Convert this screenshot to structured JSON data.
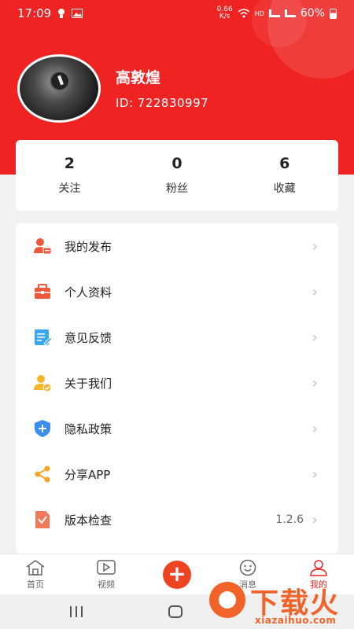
{
  "status_bar": {
    "time": "17:09",
    "net_speed_top": "0.66",
    "net_speed_unit": "K/s",
    "hd_label": "HD",
    "battery": "60%"
  },
  "profile": {
    "name": "高敦煌",
    "id_text": "ID: 722830997"
  },
  "stats": [
    {
      "value": "2",
      "label": "关注"
    },
    {
      "value": "0",
      "label": "粉丝"
    },
    {
      "value": "6",
      "label": "收藏"
    }
  ],
  "menu": [
    {
      "label": "我的发布",
      "icon": "user-post-icon",
      "value": ""
    },
    {
      "label": "个人资料",
      "icon": "toolbox-icon",
      "value": ""
    },
    {
      "label": "意见反馈",
      "icon": "edit-note-icon",
      "value": ""
    },
    {
      "label": "关于我们",
      "icon": "user-check-icon",
      "value": ""
    },
    {
      "label": "隐私政策",
      "icon": "shield-plus-icon",
      "value": ""
    },
    {
      "label": "分享APP",
      "icon": "share-icon",
      "value": ""
    },
    {
      "label": "版本检查",
      "icon": "version-file-icon",
      "value": "1.2.6"
    }
  ],
  "tabbar": {
    "home": "首页",
    "video": "视频",
    "messages": "消息",
    "mine": "我的"
  },
  "watermark": {
    "text": "下载火",
    "url": "xiazaihuo.com"
  },
  "colors": {
    "primary_red": "#ee2322",
    "watermark_orange": "#f2632a"
  }
}
